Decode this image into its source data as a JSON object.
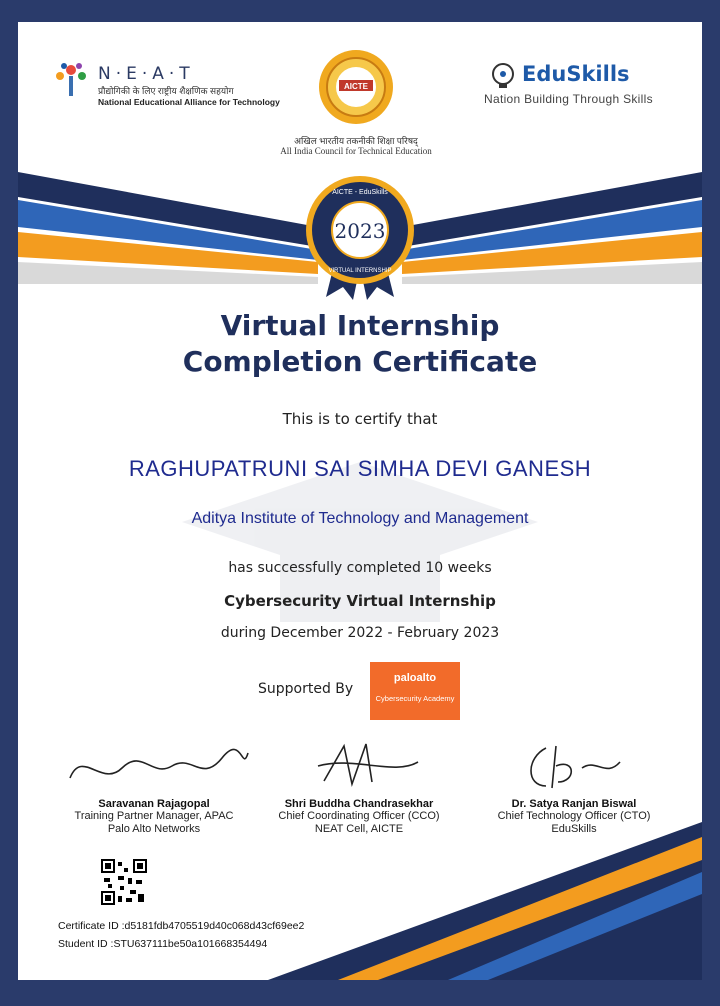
{
  "header": {
    "neat": {
      "word": "N·E·A·T",
      "hindi": "प्रौद्योगिकी के लिए राष्ट्रीय शैक्षणिक सहयोग",
      "english": "National Educational Alliance for Technology"
    },
    "aicte": {
      "logo_text": "AICTE",
      "hindi": "अखिल भारतीय तकनीकी शिक्षा परिषद्",
      "english": "All India Council for Technical Education"
    },
    "eduskills": {
      "brand": "EduSkills",
      "tagline": "Nation Building Through Skills"
    }
  },
  "seal": {
    "year": "2023",
    "ring_top": "AICTE - EduSkills",
    "ring_bottom": "VIRTUAL INTERNSHIP"
  },
  "certificate": {
    "title_line1": "Virtual Internship",
    "title_line2": "Completion Certificate",
    "certify_text": "This is to certify that",
    "student_name": "RAGHUPATRUNI  SAI SIMHA DEVI GANESH",
    "college": "Aditya Institute of Technology and Management",
    "completion_text": "has successfully completed 10 weeks",
    "course": "Cybersecurity Virtual Internship",
    "duration": "during December 2022 - February 2023",
    "supported_by": "Supported By"
  },
  "sponsor": {
    "name": "paloalto",
    "subtitle": "Cybersecurity Academy"
  },
  "signatories": [
    {
      "name": "Saravanan Rajagopal",
      "role1": "Training Partner Manager, APAC",
      "role2": "Palo Alto Networks"
    },
    {
      "name": "Shri Buddha Chandrasekhar",
      "role1": "Chief Coordinating Officer (CCO)",
      "role2": "NEAT Cell, AICTE"
    },
    {
      "name": "Dr. Satya Ranjan Biswal",
      "role1": "Chief Technology Officer (CTO)",
      "role2": "EduSkills"
    }
  ],
  "footer": {
    "certificate_id": "Certificate ID :d5181fdb4705519d40c068d43cf69ee2",
    "student_id": "Student ID :STU637111be50a101668354494"
  },
  "colors": {
    "navy": "#1f2f5c",
    "orange": "#f39c1f",
    "name_blue": "#1f2b8f"
  }
}
